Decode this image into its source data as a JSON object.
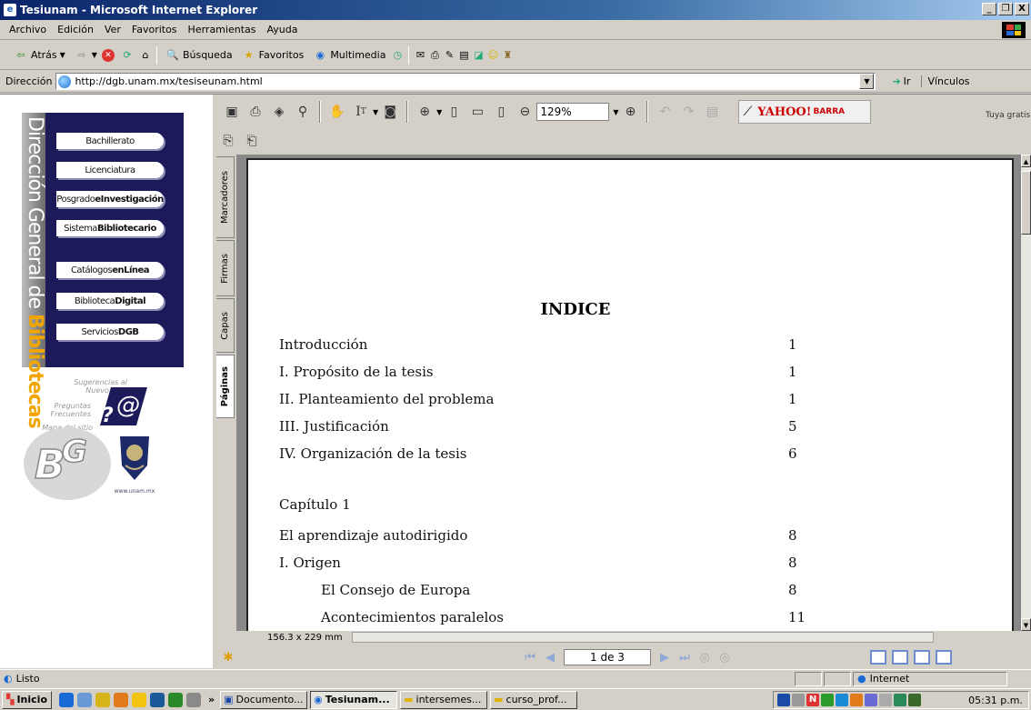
{
  "window": {
    "title": "Tesiunam - Microsoft Internet Explorer",
    "minimize": "_",
    "restore": "❐",
    "close": "X"
  },
  "menu": {
    "items": [
      "Archivo",
      "Edición",
      "Ver",
      "Favoritos",
      "Herramientas",
      "Ayuda"
    ]
  },
  "toolbar": {
    "back_label": "Atrás",
    "search_label": "Búsqueda",
    "favorites_label": "Favoritos",
    "multimedia_label": "Multimedia"
  },
  "address": {
    "label": "Dirección",
    "url": "http://dgb.unam.mx/tesiseunam.html",
    "go_label": "Ir",
    "links_label": "Vínculos"
  },
  "dgb": {
    "vertical_text_a": "Dirección General de ",
    "vertical_text_b": "Bibliotecas",
    "buttons": [
      {
        "a": "Bachillerato",
        "b": ""
      },
      {
        "a": "Licenciatura",
        "b": ""
      },
      {
        "a": "Posgrado",
        "b": "eInvestigación"
      },
      {
        "a": "Sistema",
        "b": "Bibliotecario"
      },
      {
        "a": "Catálogos",
        "b": "enLínea"
      },
      {
        "a": "Biblioteca",
        "b": "Digital"
      },
      {
        "a": "Servicios",
        "b": "DGB"
      }
    ],
    "sug_1": "Sugerencias al Nuevo Sitio",
    "sug_2": "Preguntas Frecuentes",
    "sug_3": "Mapa del sitio",
    "unam_url": "www.unam.mx"
  },
  "pdf": {
    "zoom": "129%",
    "yahoo_logo": "YAHOO!",
    "yahoo_barra": "BARRA",
    "yahoo_sub": "Tuya gratis",
    "tabs": [
      "Marcadores",
      "Firmas",
      "Capas",
      "Páginas"
    ],
    "page_size": "156.3 x 229 mm",
    "page_indicator": "1 de 3",
    "doc_title": "INDICE",
    "toc": [
      {
        "label": "Introducción",
        "page": "1",
        "indent": false
      },
      {
        "label": "I. Propósito de la tesis",
        "page": "1",
        "indent": false
      },
      {
        "label": "II. Planteamiento del problema",
        "page": "1",
        "indent": false
      },
      {
        "label": "III. Justificación",
        "page": "5",
        "indent": false
      },
      {
        "label": "IV. Organización de la tesis",
        "page": "6",
        "indent": false
      },
      {
        "label": "Capítulo 1",
        "page": "",
        "indent": false
      },
      {
        "label": "El aprendizaje autodirigido",
        "page": "8",
        "indent": false
      },
      {
        "label": "I. Origen",
        "page": "8",
        "indent": false
      },
      {
        "label": "El Consejo de Europa",
        "page": "8",
        "indent": true
      },
      {
        "label": "Acontecimientos paralelos",
        "page": "11",
        "indent": true
      }
    ]
  },
  "status": {
    "text": "Listo",
    "zone": "Internet"
  },
  "taskbar": {
    "start": "Inicio",
    "tasks": [
      "Documento...",
      "Tesiunam...",
      "intersemes...",
      "curso_prof..."
    ],
    "clock": "05:31 p.m."
  },
  "colors": {
    "title_gradient_start": "#0a246a",
    "dgb_navy": "#1d1a5a",
    "dgb_orange": "#f0a500",
    "yahoo_red": "#c00"
  }
}
